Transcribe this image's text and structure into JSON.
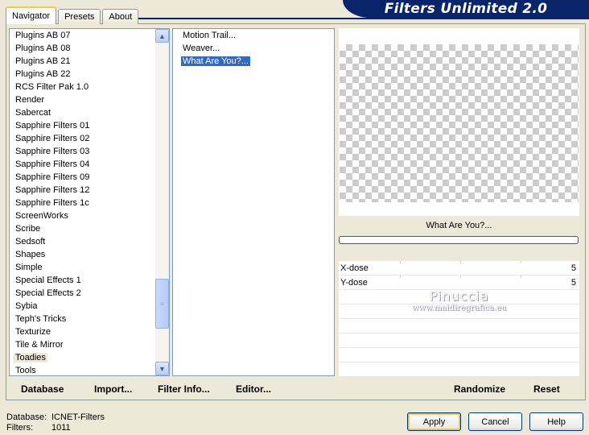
{
  "header": {
    "title": "Filters Unlimited 2.0"
  },
  "tabs": [
    {
      "label": "Navigator",
      "active": true
    },
    {
      "label": "Presets",
      "active": false
    },
    {
      "label": "About",
      "active": false
    }
  ],
  "categories": {
    "items": [
      "Plugins AB 07",
      "Plugins AB 08",
      "Plugins AB 21",
      "Plugins AB 22",
      "RCS Filter Pak 1.0",
      "Render",
      "Sabercat",
      "Sapphire Filters 01",
      "Sapphire Filters 02",
      "Sapphire Filters 03",
      "Sapphire Filters 04",
      "Sapphire Filters 09",
      "Sapphire Filters 12",
      "Sapphire Filters 1c",
      "ScreenWorks",
      "Scribe",
      "Sedsoft",
      "Shapes",
      "Simple",
      "Special Effects 1",
      "Special Effects 2",
      "Sybia",
      "Teph's Tricks",
      "Texturize",
      "Tile & Mirror",
      "Toadies",
      "Tools"
    ],
    "selected": "Toadies"
  },
  "filters": {
    "items": [
      "Motion Trail...",
      "Weaver...",
      "What Are You?..."
    ],
    "selected": "What Are You?..."
  },
  "preview": {
    "filter_name": "What Are You?..."
  },
  "params": [
    {
      "name": "X-dose",
      "value": "5"
    },
    {
      "name": "Y-dose",
      "value": "5"
    }
  ],
  "watermark": {
    "line1": "Pinuccia",
    "line2": "www.maidiregrafica.eu"
  },
  "links": {
    "database": "Database",
    "import": "Import...",
    "filter_info": "Filter Info...",
    "editor": "Editor...",
    "randomize": "Randomize",
    "reset": "Reset"
  },
  "status": {
    "database_label": "Database:",
    "database_value": "ICNET-Filters",
    "filters_label": "Filters:",
    "filters_value": "1011"
  },
  "buttons": {
    "apply": "Apply",
    "cancel": "Cancel",
    "help": "Help"
  },
  "colors": {
    "banner": "#0a246a",
    "selection": "#316ac5",
    "dialog_bg": "#ece9d8"
  }
}
